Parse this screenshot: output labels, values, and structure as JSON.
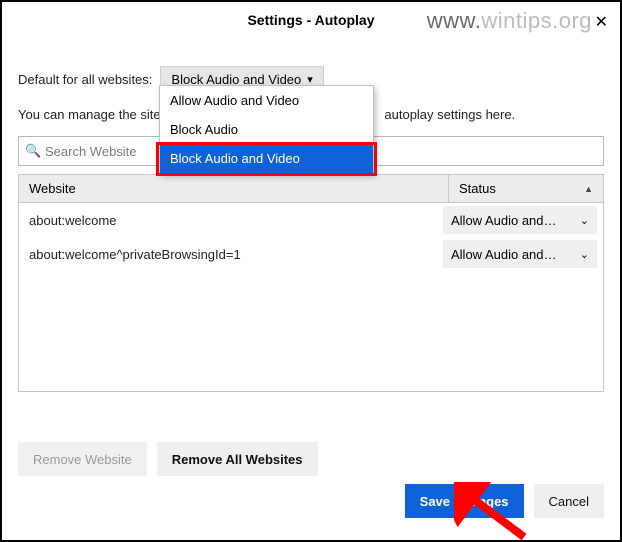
{
  "watermark": {
    "dark": "www.",
    "light": "wintips.org"
  },
  "titlebar": {
    "title": "Settings - Autoplay"
  },
  "labels": {
    "default_for": "Default for all websites:",
    "manage_sites": "You can manage the sites that do not follow your default autoplay settings here."
  },
  "manage_visible_prefix": "You can manage the sites",
  "manage_visible_suffix": "autoplay settings here.",
  "default_select": {
    "current": "Block Audio and Video",
    "options": [
      "Allow Audio and Video",
      "Block Audio",
      "Block Audio and Video"
    ]
  },
  "search": {
    "placeholder": "Search Website"
  },
  "table": {
    "headers": {
      "website": "Website",
      "status": "Status"
    },
    "rows": [
      {
        "site": "about:welcome",
        "status": "Allow Audio and…"
      },
      {
        "site": "about:welcome^privateBrowsingId=1",
        "status": "Allow Audio and…"
      }
    ]
  },
  "buttons": {
    "remove_website": "Remove Website",
    "remove_all": "Remove All Websites",
    "save": "Save Changes",
    "cancel": "Cancel"
  }
}
